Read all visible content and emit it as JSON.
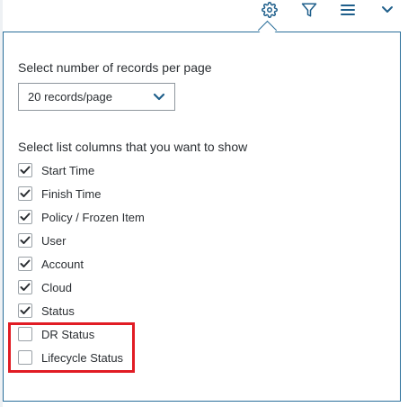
{
  "toolbar": {
    "icons": [
      "gear-icon",
      "filter-icon",
      "hamburger-menu-icon",
      "chevron-down-icon"
    ],
    "icon_color": "#1f5f8b"
  },
  "records": {
    "label": "Select number of records per page",
    "selected": "20 records/page"
  },
  "columns": {
    "label": "Select list columns that you want to show",
    "items": [
      {
        "label": "Start Time",
        "checked": true
      },
      {
        "label": "Finish Time",
        "checked": true
      },
      {
        "label": "Policy / Frozen Item",
        "checked": true
      },
      {
        "label": "User",
        "checked": true
      },
      {
        "label": "Account",
        "checked": true
      },
      {
        "label": "Cloud",
        "checked": true
      },
      {
        "label": "Status",
        "checked": true
      },
      {
        "label": "DR Status",
        "checked": false
      },
      {
        "label": "Lifecycle Status",
        "checked": false
      }
    ]
  },
  "colors": {
    "accent": "#1f5f8b",
    "panel_border": "#2a6f9a",
    "highlight": "#e11c24",
    "check": "#2b2f33"
  }
}
